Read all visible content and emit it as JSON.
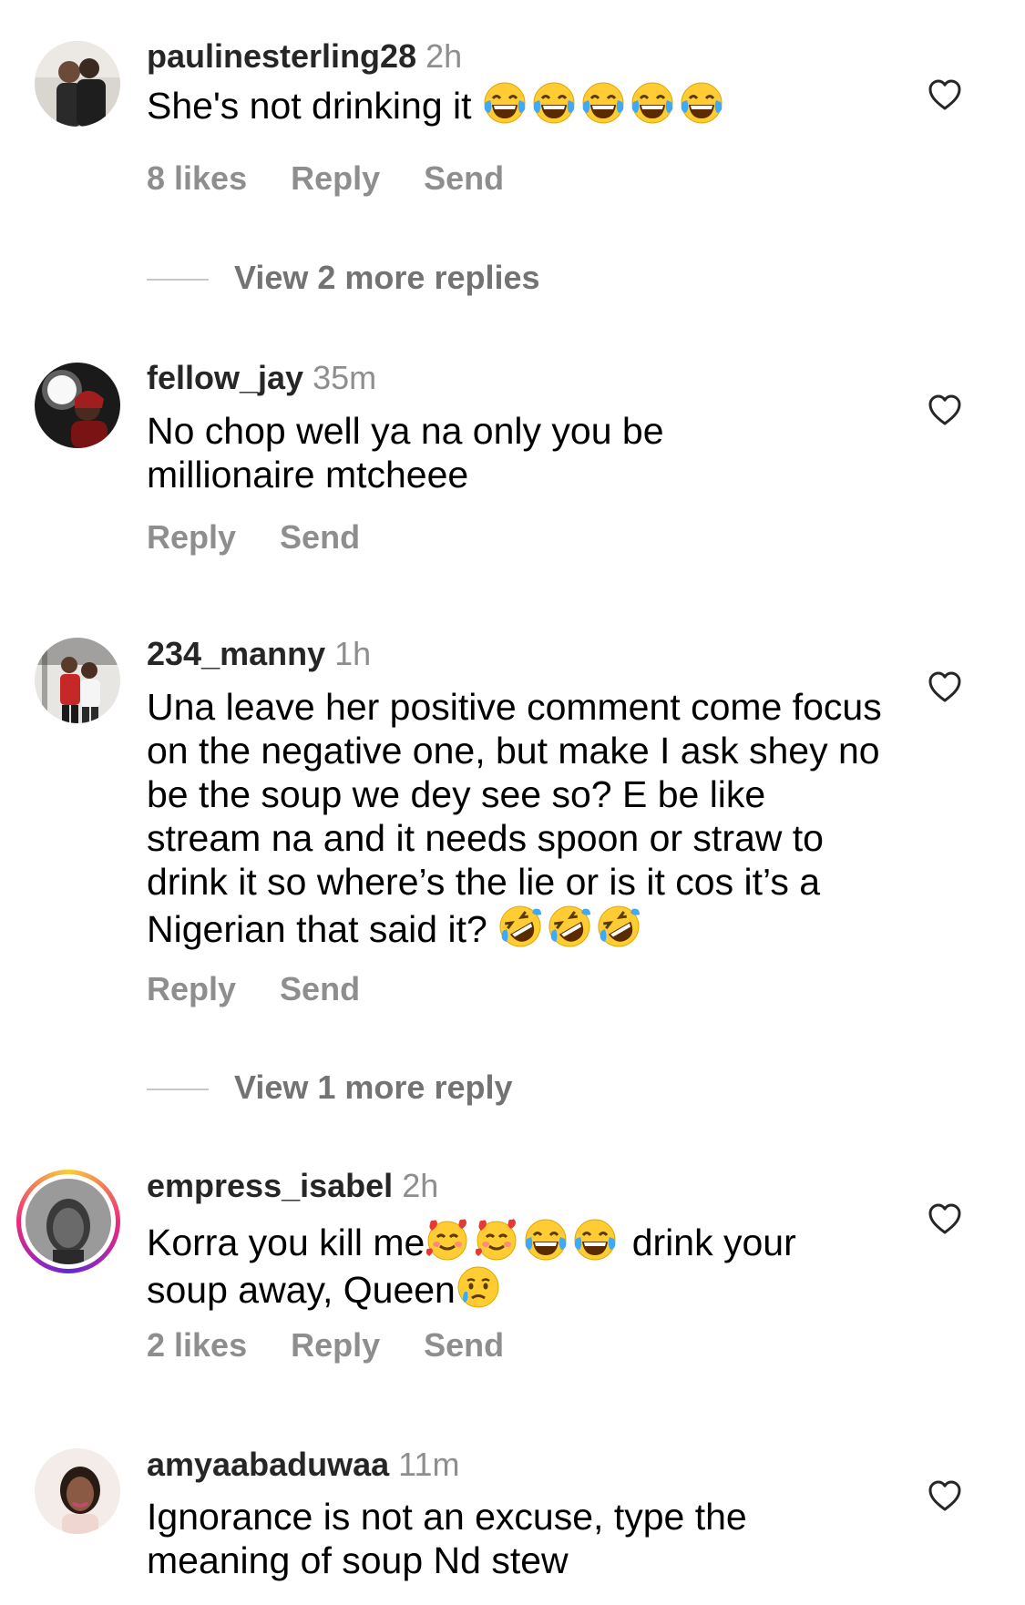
{
  "comments": [
    {
      "username": "paulinesterling28",
      "time": "2h",
      "text": "She's not drinking it",
      "likes": "8 likes",
      "reply": "Reply",
      "send": "Send",
      "view_more": "View 2 more replies"
    },
    {
      "username": "fellow_jay",
      "time": "35m",
      "text": "No chop well ya na only you be millionaire mtcheee",
      "reply": "Reply",
      "send": "Send"
    },
    {
      "username": "234_manny",
      "time": "1h",
      "text": "Una leave her positive comment come focus on the negative one, but make I ask shey no be the soup we dey see so? E be like stream na and it needs spoon or straw to drink it so where’s the lie or is it cos it’s a Nigerian that said it?",
      "reply": "Reply",
      "send": "Send",
      "view_more": "View 1 more reply"
    },
    {
      "username": "empress_isabel",
      "time": "2h",
      "text_a": "Korra you kill me",
      "text_b": " drink your soup away, Queen",
      "likes": "2 likes",
      "reply": "Reply",
      "send": "Send"
    },
    {
      "username": "amyaabaduwaa",
      "time": "11m",
      "text": "Ignorance is not an excuse, type the meaning of soup Nd stew"
    }
  ],
  "icons": {
    "heart": "heart-outline-icon",
    "laugh": "face-with-tears-of-joy-emoji",
    "rofl": "rolling-on-floor-laughing-emoji",
    "hearts_face": "smiling-face-with-hearts-emoji",
    "tear": "crying-face-emoji"
  },
  "colors": {
    "username": "#262626",
    "secondary": "#8e8e8e",
    "story_ring": "#ee2a7b"
  }
}
